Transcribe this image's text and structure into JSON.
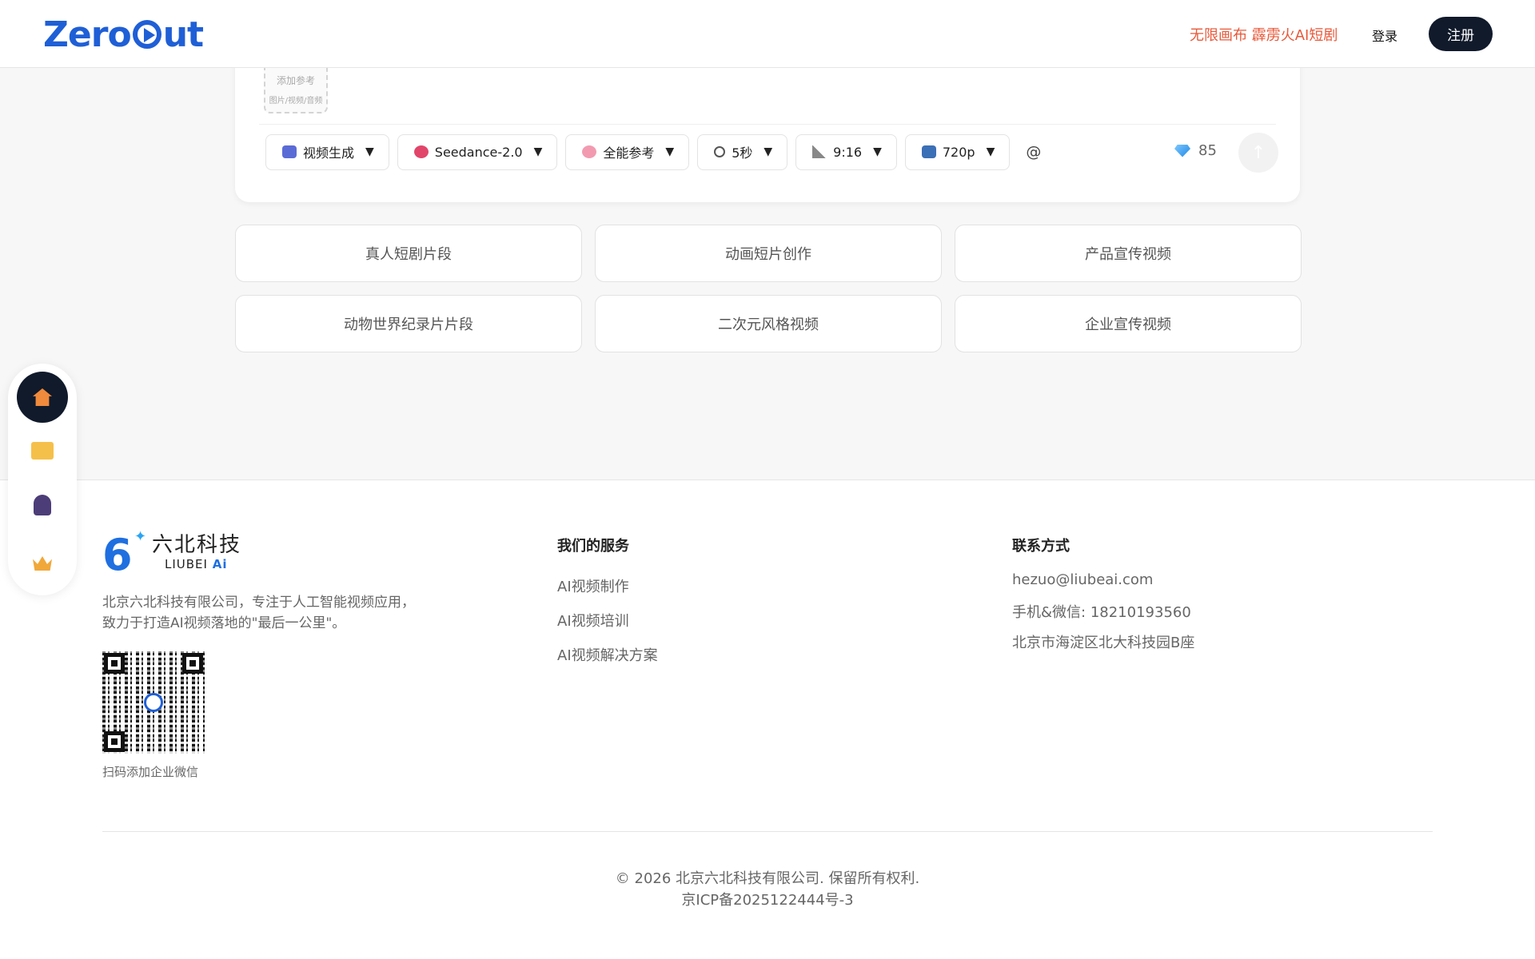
{
  "header": {
    "logo": "ZeroCut",
    "promo": "无限画布 霹雳火AI短剧",
    "login": "登录",
    "register": "注册"
  },
  "composer": {
    "reference": {
      "line1": "添加参考",
      "line2": "图片/视频/音频"
    },
    "toolbar": [
      {
        "label": "视频生成",
        "icon": "robot-icon"
      },
      {
        "label": "Seedance-2.0",
        "icon": "target-icon"
      },
      {
        "label": "全能参考",
        "icon": "brain-icon"
      },
      {
        "label": "5秒",
        "icon": "stopwatch-icon"
      },
      {
        "label": "9:16",
        "icon": "ratio-icon"
      },
      {
        "label": "720p",
        "icon": "tv-icon"
      }
    ],
    "mention": "@",
    "credits": "85"
  },
  "templates": [
    "真人短剧片段",
    "动画短片创作",
    "产品宣传视频",
    "动物世界纪录片片段",
    "二次元风格视频",
    "企业宣传视频"
  ],
  "dock": [
    "home-icon",
    "folder-icon",
    "user-icon",
    "crown-icon"
  ],
  "footer": {
    "brand_cn": "六北科技",
    "brand_en": "LIUBEI",
    "brand_ai": "Ai",
    "desc_line1": "北京六北科技有限公司，专注于人工智能视频应用，",
    "desc_line2": "致力于打造AI视频落地的\"最后一公里\"。",
    "qr_caption": "扫码添加企业微信",
    "services_title": "我们的服务",
    "services": [
      "AI视频制作",
      "AI视频培训",
      "AI视频解决方案"
    ],
    "contact_title": "联系方式",
    "contact": [
      "hezuo@liubeai.com",
      "手机&微信: 18210193560",
      "北京市海淀区北大科技园B座"
    ],
    "copyright": "© 2026 北京六北科技有限公司. 保留所有权利.",
    "icp": "京ICP备2025122444号-3"
  }
}
